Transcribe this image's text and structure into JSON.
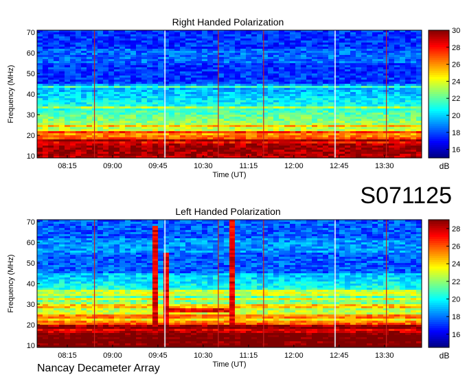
{
  "observation_code": "S071125",
  "instrument": "Nancay Decameter Array",
  "colors": {
    "colormap": [
      "#00007f",
      "#0000ff",
      "#0080ff",
      "#00ffff",
      "#80ff80",
      "#ffff00",
      "#ff8000",
      "#ff0000",
      "#7f0000"
    ],
    "vertical_line_red": "#c8201e",
    "vertical_line_white": "#e8f4ff"
  },
  "chart_data": [
    {
      "type": "heatmap",
      "title": "Right Handed Polarization",
      "xlabel": "Time (UT)",
      "ylabel": "Frequency (MHz)",
      "colorbar_label": "dB",
      "x_ticks": [
        "08:15",
        "09:00",
        "09:45",
        "10:30",
        "11:15",
        "12:00",
        "12:45",
        "13:30"
      ],
      "x_range": [
        "07:45",
        "14:07"
      ],
      "y_ticks": [
        10,
        20,
        30,
        40,
        50,
        60,
        70
      ],
      "y_range": [
        9,
        71
      ],
      "colorbar_ticks": [
        16,
        18,
        20,
        22,
        24,
        26,
        28,
        30
      ],
      "colorbar_range": [
        15,
        30
      ],
      "vertical_lines": [
        {
          "time": "08:42",
          "color": "red"
        },
        {
          "time": "09:52",
          "color": "white"
        },
        {
          "time": "10:45",
          "color": "red"
        },
        {
          "time": "11:30",
          "color": "red"
        },
        {
          "time": "12:41",
          "color": "white"
        },
        {
          "time": "13:32",
          "color": "red"
        }
      ],
      "bursts": []
    },
    {
      "type": "heatmap",
      "title": "Left Handed Polarization",
      "xlabel": "Time (UT)",
      "ylabel": "Frequency (MHz)",
      "colorbar_label": "dB",
      "x_ticks": [
        "08:15",
        "09:00",
        "09:45",
        "10:30",
        "11:15",
        "12:00",
        "12:45",
        "13:30"
      ],
      "x_range": [
        "07:45",
        "14:07"
      ],
      "y_ticks": [
        10,
        20,
        30,
        40,
        50,
        60,
        70
      ],
      "y_range": [
        9,
        71
      ],
      "colorbar_ticks": [
        16,
        18,
        20,
        22,
        24,
        26,
        28
      ],
      "colorbar_range": [
        14.5,
        29
      ],
      "vertical_lines": [
        {
          "time": "08:42",
          "color": "red"
        },
        {
          "time": "09:52",
          "color": "white"
        },
        {
          "time": "10:45",
          "color": "red"
        },
        {
          "time": "11:30",
          "color": "red"
        },
        {
          "time": "12:41",
          "color": "white"
        },
        {
          "time": "13:32",
          "color": "red"
        }
      ],
      "bursts": [
        {
          "start": "09:40",
          "end": "09:45",
          "f_min": 10,
          "f_max": 68
        },
        {
          "start": "09:53",
          "end": "09:58",
          "f_min": 10,
          "f_max": 55
        },
        {
          "start": "10:55",
          "end": "11:04",
          "f_min": 10,
          "f_max": 71
        },
        {
          "start": "09:58",
          "end": "10:58",
          "f_min": 26,
          "f_max": 28
        }
      ]
    }
  ]
}
